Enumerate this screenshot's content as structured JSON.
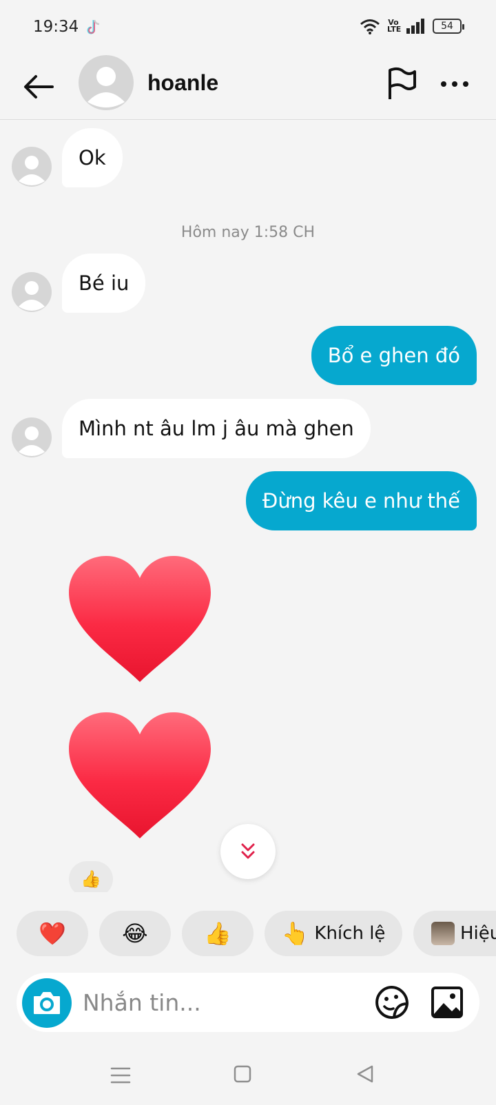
{
  "status_bar": {
    "time": "19:34",
    "volte": "Vo\nLTE",
    "battery": "54"
  },
  "header": {
    "username": "hoanle",
    "back_icon": "arrow-left-icon",
    "flag_icon": "flag-icon",
    "more_icon": "more-horizontal-icon"
  },
  "chat": {
    "timestamp": "Hôm nay 1:58 CH",
    "messages": [
      {
        "side": "in",
        "text": "Ok"
      },
      {
        "side": "in",
        "text": "Bé iu"
      },
      {
        "side": "out",
        "text": "Bổ e ghen đó"
      },
      {
        "side": "in",
        "text": "Mình nt âu lm j âu mà ghen"
      },
      {
        "side": "out",
        "text": "Đừng kêu e như thế"
      },
      {
        "side": "in",
        "sticker": "heart"
      },
      {
        "side": "in",
        "sticker": "heart"
      }
    ],
    "reaction": "👍"
  },
  "quick_replies": [
    {
      "emoji": "❤️",
      "label": ""
    },
    {
      "emoji": "😂",
      "label": ""
    },
    {
      "emoji": "👍",
      "label": ""
    },
    {
      "emoji": "👆",
      "label": "Khích lệ"
    },
    {
      "emoji": "",
      "label": "Hiệu"
    }
  ],
  "composer": {
    "placeholder": "Nhắn tin..."
  },
  "colors": {
    "accent": "#06a8cf",
    "background": "#f4f4f4",
    "bubble_in": "#ffffff",
    "heart": "#f0253f"
  }
}
